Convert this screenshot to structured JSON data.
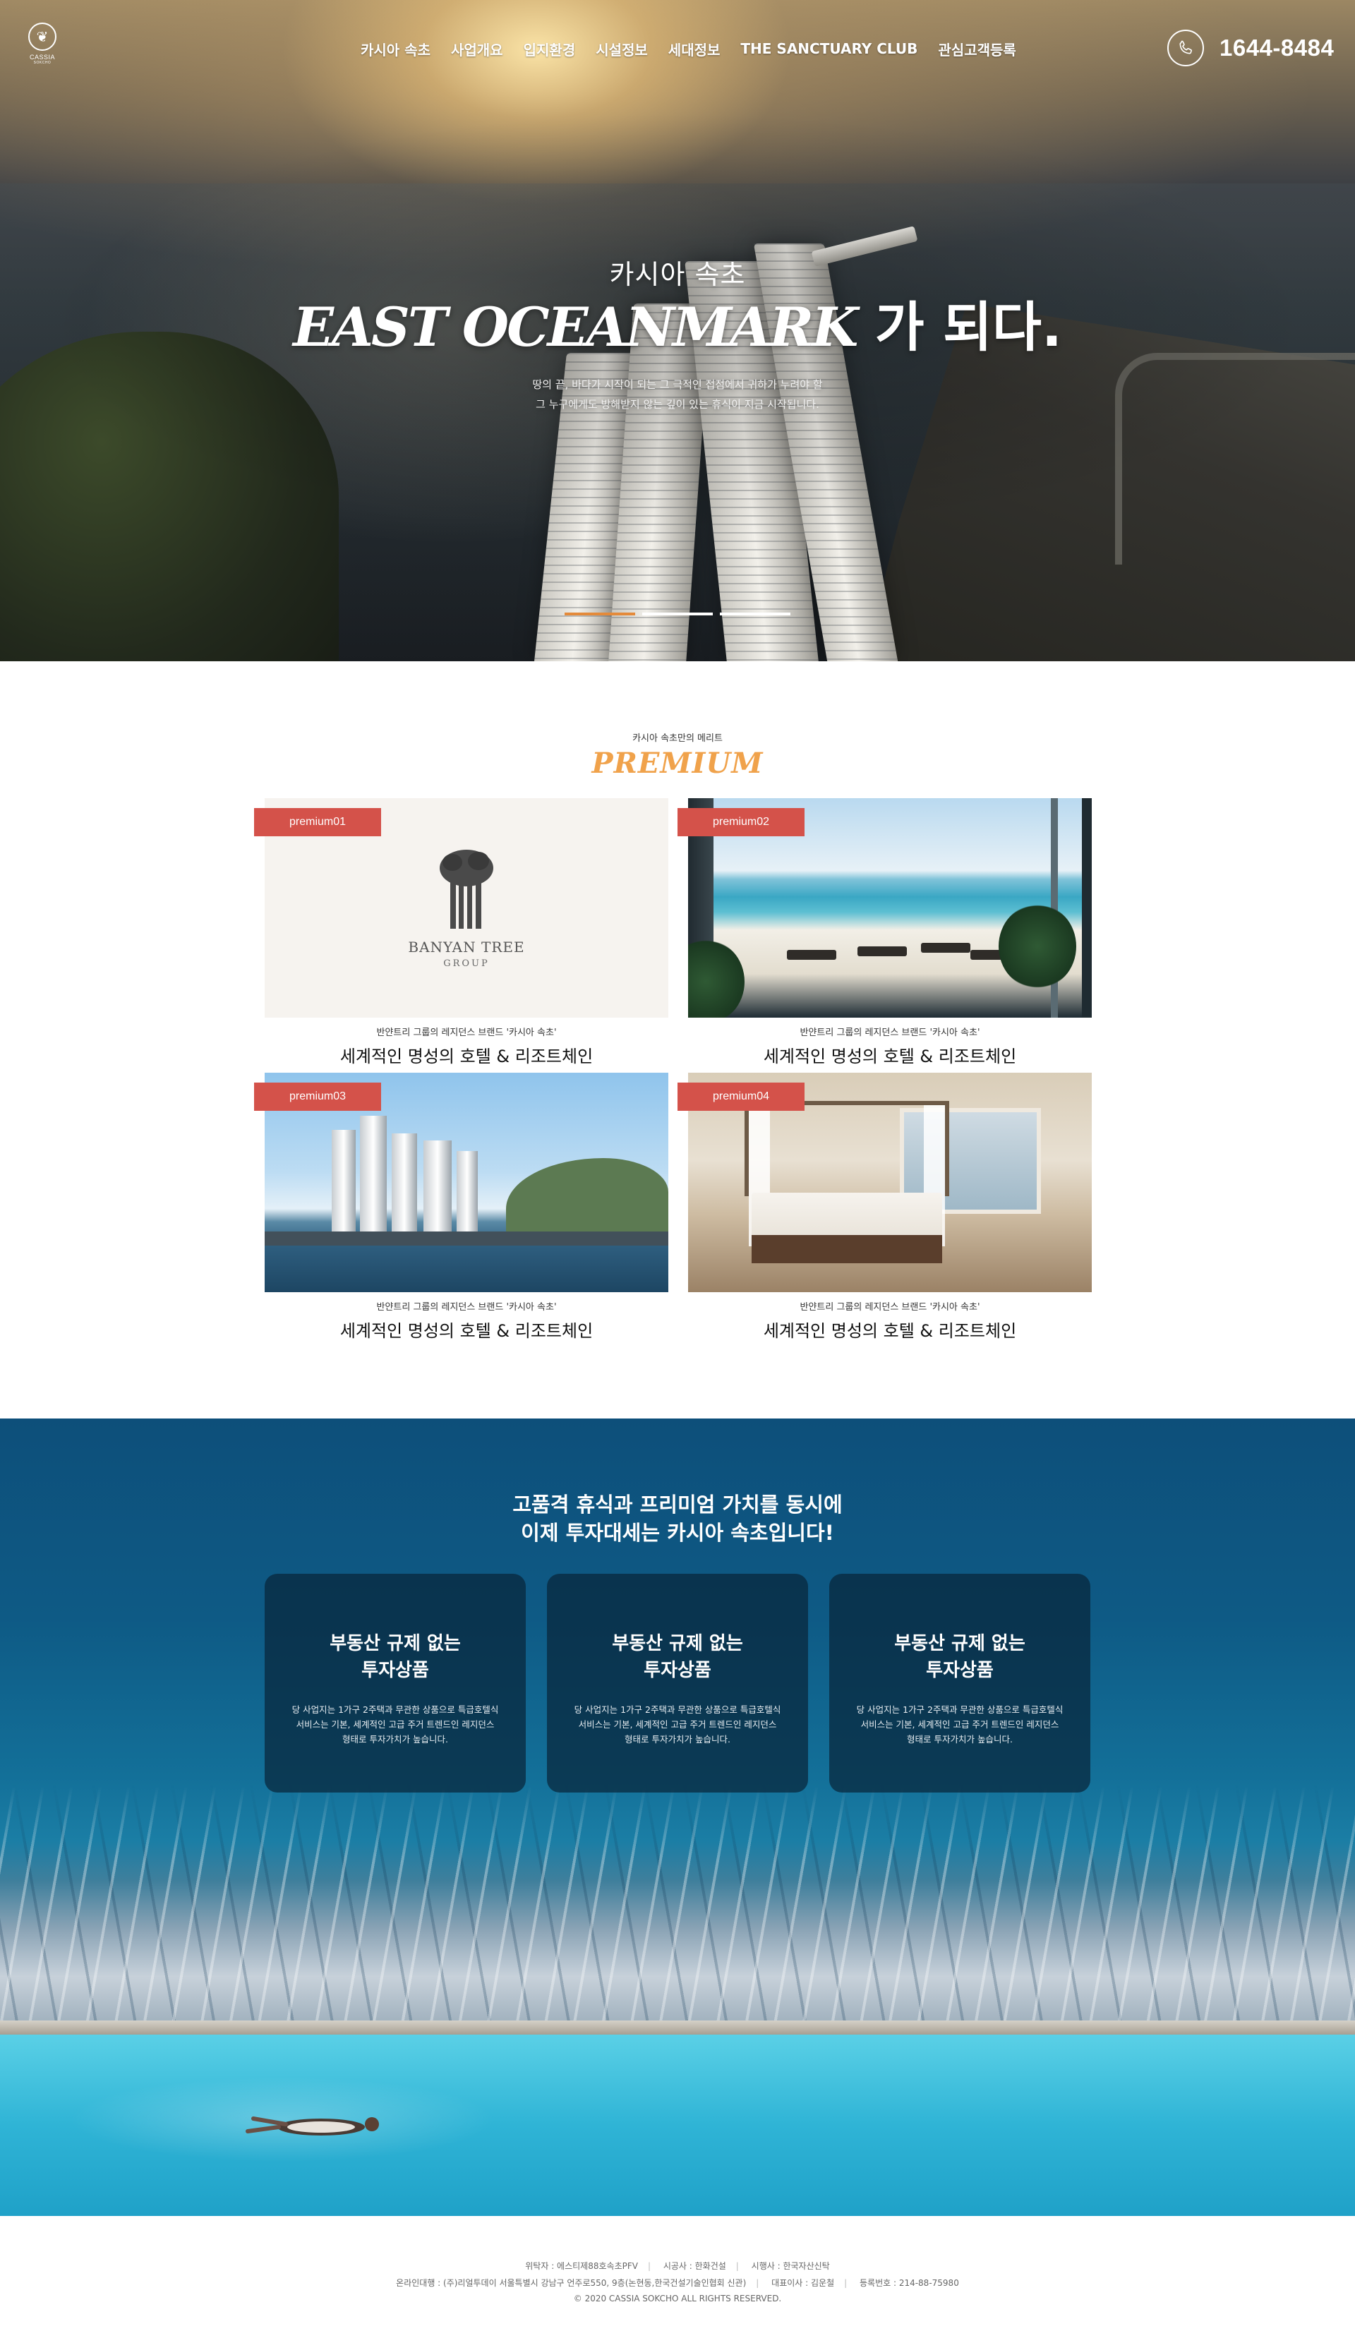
{
  "header": {
    "logo": {
      "name": "CASSIA",
      "sub": "SOKCHO"
    },
    "nav": [
      "카시아 속초",
      "사업개요",
      "입지환경",
      "시설정보",
      "세대정보",
      "THE SANCTUARY CLUB",
      "관심고객등록"
    ],
    "phone": "1644-8484",
    "phone_icon": "phone-icon"
  },
  "hero": {
    "kicker": "카시아 속초",
    "title_brand": "EAST OCEANMARK",
    "title_suffix": " 가 되다.",
    "desc_line1": "땅의 끝, 바다가 시작이 되는 그 극적인 접점에서 귀하가 누려야 할",
    "desc_line2": "그 누구에게도 방해받지 않는 깊이 있는 휴식이 지금 시작됩니다.",
    "slides": 3,
    "active_slide": 1
  },
  "premium": {
    "kicker": "카시아 속초만의 메리트",
    "title": "PREMIUM",
    "cards": [
      {
        "tag": "premium01",
        "sub": "반얀트리 그룹의 레지던스 브랜드 '카시아 속초'",
        "title": "세계적인 명성의 호텔 & 리조트체인",
        "brand_word": "BANYAN TREE",
        "brand_sub": "GROUP"
      },
      {
        "tag": "premium02",
        "sub": "반얀트리 그룹의 레지던스 브랜드 '카시아 속초'",
        "title": "세계적인 명성의 호텔 & 리조트체인"
      },
      {
        "tag": "premium03",
        "sub": "반얀트리 그룹의 레지던스 브랜드 '카시아 속초'",
        "title": "세계적인 명성의 호텔 & 리조트체인"
      },
      {
        "tag": "premium04",
        "sub": "반얀트리 그룹의 레지던스 브랜드 '카시아 속초'",
        "title": "세계적인 명성의 호텔 & 리조트체인"
      }
    ]
  },
  "invest": {
    "head_line1": "고품격 휴식과 프리미엄 가치를 동시에",
    "head_line2": "이제 투자대세는 카시아 속초입니다!",
    "cards": [
      {
        "title_line1": "부동산 규제 없는",
        "title_line2": "투자상품",
        "text_line1": "당 사업지는 1가구 2주택과 무관한 상품으로 특급호텔식",
        "text_line2": "서비스는 기본, 세계적인 고급 주거 트렌드인 레지던스",
        "text_line3": "형태로 투자가치가 높습니다."
      },
      {
        "title_line1": "부동산 규제 없는",
        "title_line2": "투자상품",
        "text_line1": "당 사업지는 1가구 2주택과 무관한 상품으로 특급호텔식",
        "text_line2": "서비스는 기본, 세계적인 고급 주거 트렌드인 레지던스",
        "text_line3": "형태로 투자가치가 높습니다."
      },
      {
        "title_line1": "부동산 규제 없는",
        "title_line2": "투자상품",
        "text_line1": "당 사업지는 1가구 2주택과 무관한 상품으로 특급호텔식",
        "text_line2": "서비스는 기본, 세계적인 고급 주거 트렌드인 레지던스",
        "text_line3": "형태로 투자가치가 높습니다."
      }
    ]
  },
  "footer": {
    "row1": [
      "위탁자 : 에스티제88호속초PFV",
      "시공사 : 한화건설",
      "시행사 : 한국자산신탁"
    ],
    "row2": [
      "온라인대행 : (주)리얼투데이 서울특별시 강남구 언주로550, 9층(논현동,한국건설기술인협회 신관)",
      "대표이사 : 김운철",
      "등록번호 : 214-88-75980"
    ],
    "copyright": "© 2020 CASSIA SOKCHO ALL RIGHTS RESERVED."
  },
  "colors": {
    "accent_orange": "#e48a3a",
    "premium_title": "#f0a24b",
    "tag_red": "#d4524a",
    "invest_card_bg": "rgba(8,38,58,0.72)"
  }
}
